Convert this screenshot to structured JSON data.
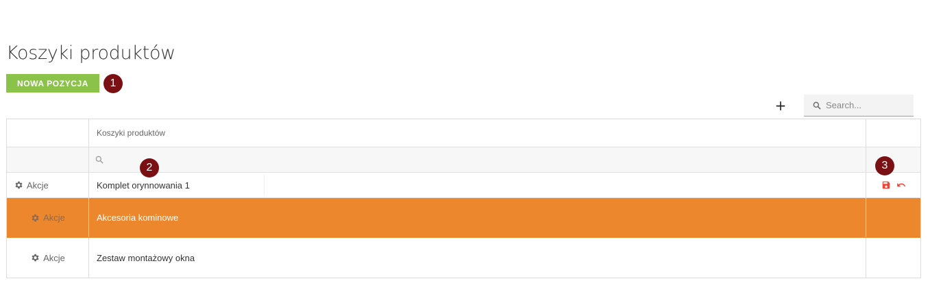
{
  "page": {
    "title": "Koszyki produktów"
  },
  "toolbar": {
    "new_button_label": "NOWA POZYCJA",
    "add_symbol": "+"
  },
  "search": {
    "placeholder": "Search..."
  },
  "grid": {
    "column_header": "Koszyki produktów",
    "rows": [
      {
        "actions_label": "Akcje",
        "value": "Komplet orynnowania 1",
        "state": "editing"
      },
      {
        "actions_label": "Akcje",
        "value": "Akcesoria kominowe",
        "state": "selected"
      },
      {
        "actions_label": "Akcje",
        "value": "Zestaw montażowy okna",
        "state": "normal"
      }
    ]
  },
  "markers": [
    "1",
    "2",
    "3"
  ],
  "colors": {
    "accent_green": "#8bc34a",
    "selected_row": "#ed872d",
    "marker": "#7b1014",
    "edit_action_red": "#f44336"
  }
}
